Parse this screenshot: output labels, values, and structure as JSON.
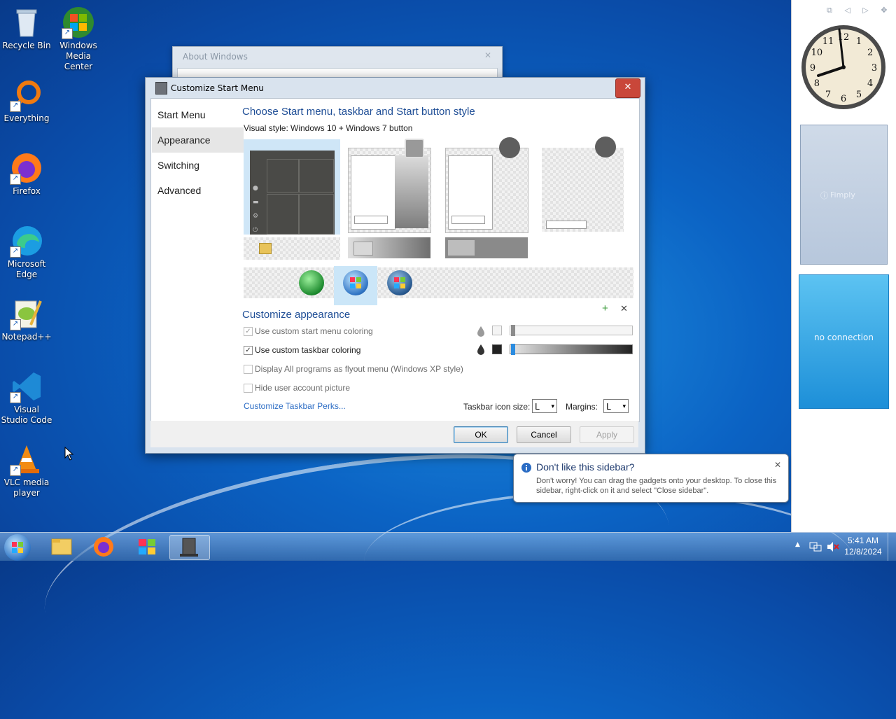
{
  "desktop_icons": [
    {
      "label": "Recycle Bin",
      "icon": "recycle-bin-icon"
    },
    {
      "label": "Windows Media Center",
      "icon": "windows-media-center-icon"
    },
    {
      "label": "Everything",
      "icon": "everything-icon"
    },
    {
      "label": "Firefox",
      "icon": "firefox-icon"
    },
    {
      "label": "Microsoft Edge",
      "icon": "edge-icon"
    },
    {
      "label": "Notepad++",
      "icon": "notepadpp-icon"
    },
    {
      "label": "Visual Studio Code",
      "icon": "vscode-icon"
    },
    {
      "label": "VLC media player",
      "icon": "vlc-icon"
    }
  ],
  "about_window": {
    "title": "About Windows",
    "close": "✕"
  },
  "dialog": {
    "title": "Customize Start Menu",
    "close": "✕",
    "nav": [
      "Start Menu",
      "Appearance",
      "Switching",
      "Advanced"
    ],
    "heading": "Choose Start menu, taskbar and Start button style",
    "visual_style_label": "Visual style:",
    "visual_style_value": "Windows 10 + Windows 7 button",
    "customize_heading": "Customize appearance",
    "add_glyph": "+",
    "remove_glyph": "✕",
    "options": [
      {
        "label": "Use custom start menu coloring",
        "checked": true,
        "enabled": false
      },
      {
        "label": "Use custom taskbar coloring",
        "checked": true,
        "enabled": true
      },
      {
        "label": "Display All programs as flyout menu (Windows XP style)",
        "checked": false,
        "enabled": false
      },
      {
        "label": "Hide user account picture",
        "checked": false,
        "enabled": false
      }
    ],
    "check_glyph": "✓",
    "perks_link": "Customize Taskbar Perks...",
    "icon_size_label": "Taskbar icon size:",
    "icon_size_value": "L",
    "margins_label": "Margins:",
    "margins_value": "L",
    "dropdown_arrow": "▾",
    "buttons": {
      "ok": "OK",
      "cancel": "Cancel",
      "apply": "Apply"
    }
  },
  "sidebar": {
    "controls": "⧉ ◁ ▷ ✥",
    "gadget_label": "Fimply",
    "weather_text": "no connection",
    "clock_numbers": [
      "12",
      "1",
      "2",
      "3",
      "4",
      "5",
      "6",
      "7",
      "8",
      "9",
      "10",
      "11"
    ]
  },
  "balloon": {
    "title": "Don't like this sidebar?",
    "message": "Don't worry! You can drag the gadgets onto your desktop. To close this sidebar, right-click on it and select \"Close sidebar\".",
    "close": "✕"
  },
  "taskbar": {
    "time": "5:41 AM",
    "date": "12/8/2024",
    "tray_arrow": "▲"
  }
}
